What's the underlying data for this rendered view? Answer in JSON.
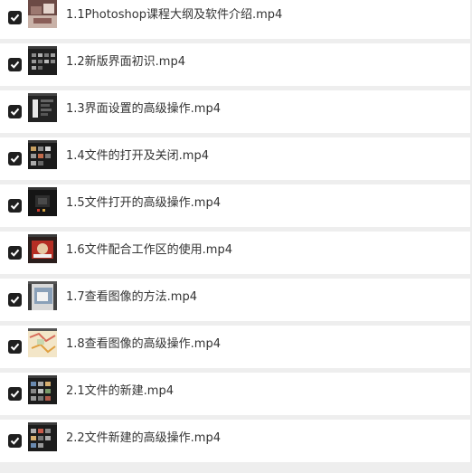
{
  "files": [
    {
      "name": "1.1Photoshop课程大纲及软件介绍.mp4",
      "checked": true,
      "thumbnail": "thumb-photo"
    },
    {
      "name": "1.2新版界面初识.mp4",
      "checked": true,
      "thumbnail": "thumb-ui-dark"
    },
    {
      "name": "1.3界面设置的高级操作.mp4",
      "checked": true,
      "thumbnail": "thumb-ui-panel"
    },
    {
      "name": "1.4文件的打开及关闭.mp4",
      "checked": true,
      "thumbnail": "thumb-ui-grid"
    },
    {
      "name": "1.5文件打开的高级操作.mp4",
      "checked": true,
      "thumbnail": "thumb-ui-dark-red"
    },
    {
      "name": "1.6文件配合工作区的使用.mp4",
      "checked": true,
      "thumbnail": "thumb-ui-red"
    },
    {
      "name": "1.7查看图像的方法.mp4",
      "checked": true,
      "thumbnail": "thumb-ui-light"
    },
    {
      "name": "1.8查看图像的高级操作.mp4",
      "checked": true,
      "thumbnail": "thumb-map"
    },
    {
      "name": "2.1文件的新建.mp4",
      "checked": true,
      "thumbnail": "thumb-ui-grid"
    },
    {
      "name": "2.2文件新建的高级操作.mp4",
      "checked": true,
      "thumbnail": "thumb-ui-grid"
    }
  ]
}
